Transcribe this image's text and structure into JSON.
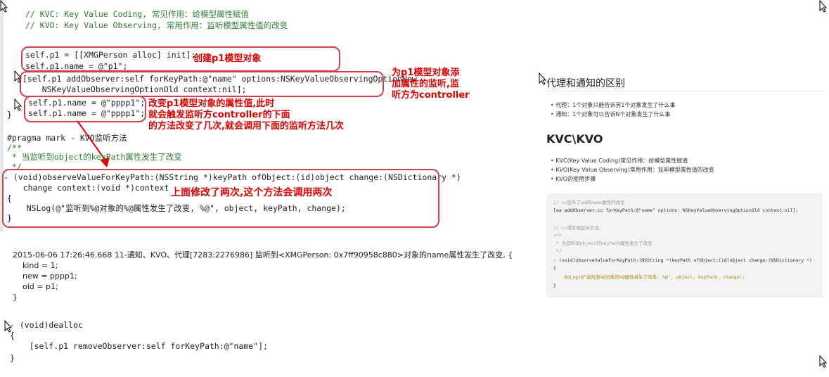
{
  "top_code": {
    "comment_kvc": "// KVC: Key Value Coding, 常见作用：给模型属性赋值",
    "comment_kvo": "// KVO: Key Value Observing, 常用作用：监听模型属性值的改变",
    "line_alloc": "self.p1 = [[XMGPerson alloc] init];",
    "line_name": "self.p1.name = @\"p1\";",
    "line_observer_1": "[self.p1 addObserver:self forKeyPath:@\"name\" options:NSKeyValueObservingOptionNew",
    "line_observer_2": "    NSKeyValueObservingOptionOld context:nil];",
    "line_set_1": "self.p1.name = @\"pppp1\";",
    "line_set_2": "self.p1.name = @\"pppp1\";",
    "brace_close": "}",
    "pragma": "#pragma mark - KVO监听方法",
    "doc_open": "/**",
    "doc_line": " * 当监听到object的keyPath属性发生了改变",
    "doc_close": " */",
    "method_sig_1": "- (void)observeValueForKeyPath:(NSString *)keyPath ofObject:(id)object change:(NSDictionary *)",
    "method_sig_2": "    change context:(void *)context",
    "brace_open": "{",
    "nslog": "    NSLog(@\"监听到%@对象的%@属性发生了改变, %@\", object, keyPath, change);",
    "brace_close2": "}"
  },
  "notes": {
    "create": "创建p1模型对象",
    "add_observer": "为p1模型对象添\n加属性的监听,监\n听方为controller",
    "change_value": "改变p1模型对象的属性值,此时\n就会触发监听方controller的下面\n的方法改变了几次,就会调用下面的监听方法几次",
    "called_twice": "上面修改了两次,这个方法会调用两次"
  },
  "log_output": {
    "line1": "2015-06-06 17:26:46.668 11-通知、KVO、代理[7283:2276986] 监听到<XMGPerson: 0x7ff90958c880>对象的name属性发生了改变, {",
    "line2": "    kind = 1;",
    "line3": "    new = pppp1;",
    "line4": "    old = p1;",
    "line5": "}"
  },
  "dealloc_code": {
    "line1": "- (void)dealloc",
    "line2": "{",
    "line3": "    [self.p1 removeObserver:self forKeyPath:@\"name\"];",
    "line4": "}"
  },
  "right_panel": {
    "title": "代理和通知的区别",
    "bullet1": "代理：1个对象只能告诉另1个对象发生了什么事",
    "bullet2": "通知：1个对象可以告诉N个对象发生了什么事",
    "heading": "KVC\\KVO",
    "bullet3": "KVC(Key Value Coding)常见作用：给模型属性赋值",
    "bullet4": "KVO(Key Value Observing)常用作用：监听模型属性值的改变",
    "bullet5": "KVO的使用步骤",
    "code1": "// cc监听了aa的name属性的改变",
    "code2": "[aa addObserver:cc forKeyPath:@\"name\" options: NSKeyValueObservingOptionOld context:nil];",
    "code3": "// cc得实现监听方法",
    "code4": "/**",
    "code5": " * 当监听到object的keyPath属性发生了改变",
    "code6": " */",
    "code7": "- (void)observeValueForKeyPath:(NSString *)keyPath ofObject:(id)object change:(NSDictionary *)",
    "code8": "{",
    "code9": "    NSLog(@\"监听到%@对象的%@属性发生了改变, %@\", object, keyPath, change);",
    "code10": "}"
  },
  "colors": {
    "annotation_red": "#e00000",
    "box_border": "#d04050",
    "comment_green": "#2e7d32"
  }
}
